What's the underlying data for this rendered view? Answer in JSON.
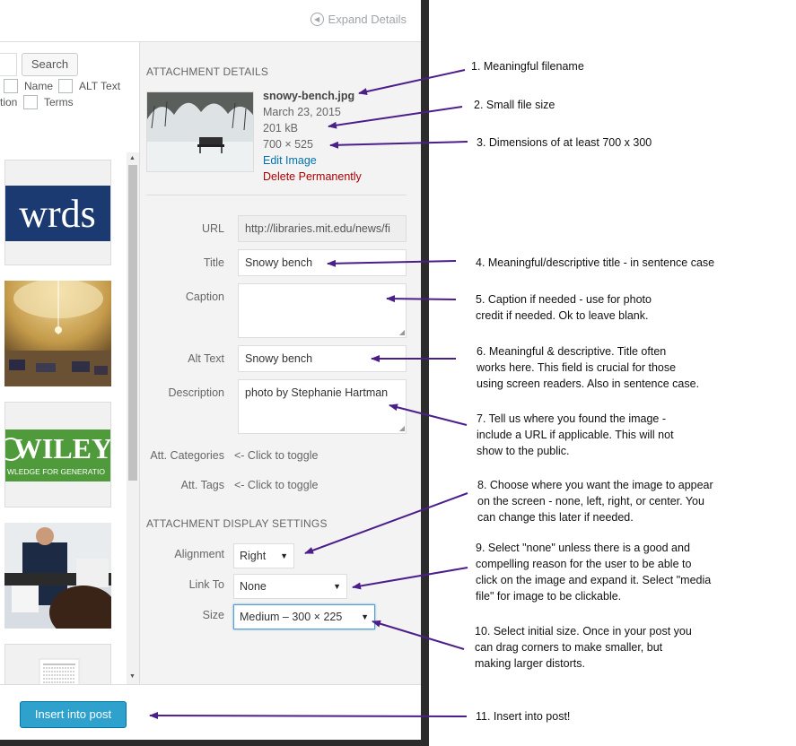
{
  "header": {
    "expand_label": "Expand Details"
  },
  "library": {
    "search_button": "Search",
    "filters": [
      "Name",
      "ALT Text",
      "tion",
      "Terms"
    ],
    "thumbnails": [
      {
        "kind": "wrds-logo",
        "text": "wrds"
      },
      {
        "kind": "library-hall-photo"
      },
      {
        "kind": "wiley-logo",
        "text": "WILEY",
        "subtext": "WLEDGE FOR GENERATIO"
      },
      {
        "kind": "lecture-photo"
      },
      {
        "kind": "document-page"
      }
    ]
  },
  "details": {
    "heading": "ATTACHMENT DETAILS",
    "filename": "snowy-bench.jpg",
    "date": "March 23, 2015",
    "filesize": "201 kB",
    "dimensions": "700 × 525",
    "edit_link": "Edit Image",
    "delete_link": "Delete Permanently",
    "fields": {
      "url": {
        "label": "URL",
        "value": "http://libraries.mit.edu/news/fi"
      },
      "title": {
        "label": "Title",
        "value": "Snowy bench"
      },
      "caption": {
        "label": "Caption",
        "value": ""
      },
      "alt": {
        "label": "Alt Text",
        "value": "Snowy bench"
      },
      "description": {
        "label": "Description",
        "value": "photo by Stephanie Hartman"
      },
      "categories": {
        "label": "Att. Categories",
        "value": "<- Click to toggle"
      },
      "tags": {
        "label": "Att. Tags",
        "value": "<- Click to toggle"
      }
    }
  },
  "display": {
    "heading": "ATTACHMENT DISPLAY SETTINGS",
    "alignment": {
      "label": "Alignment",
      "value": "Right"
    },
    "link_to": {
      "label": "Link To",
      "value": "None"
    },
    "size": {
      "label": "Size",
      "value": "Medium – 300 × 225"
    }
  },
  "footer": {
    "insert_button": "Insert into post"
  },
  "annotations": [
    [
      "1. Meaningful filename"
    ],
    [
      "2. Small file size"
    ],
    [
      "3. Dimensions of at least 700 x 300"
    ],
    [
      "4. Meaningful/descriptive title - in sentence case"
    ],
    [
      "5. Caption if needed - use for photo",
      "credit if needed. Ok to leave blank."
    ],
    [
      "6. Meaningful & descriptive. Title often",
      "works here. This field is crucial for those",
      "using screen readers. Also in sentence case."
    ],
    [
      "7. Tell us where you found the image -",
      "include a URL if applicable. This will not",
      "show to the public."
    ],
    [
      "8. Choose where you want the image to appear",
      "on the screen - none, left, right, or center. You",
      "can change this later if needed."
    ],
    [
      "9. Select \"none\" unless there is a good and",
      "compelling reason for the user to be able to",
      "click on the image and expand it. Select \"media",
      "file\" for image to be clickable."
    ],
    [
      "10. Select initial size. Once in your post you",
      "can drag corners to make smaller, but",
      "making larger distorts."
    ],
    [
      "11. Insert into post!"
    ]
  ],
  "colors": {
    "arrow": "#4b1e8a",
    "primary_button": "#2ea2cc",
    "link": "#0073aa",
    "delete": "#aa0000"
  }
}
